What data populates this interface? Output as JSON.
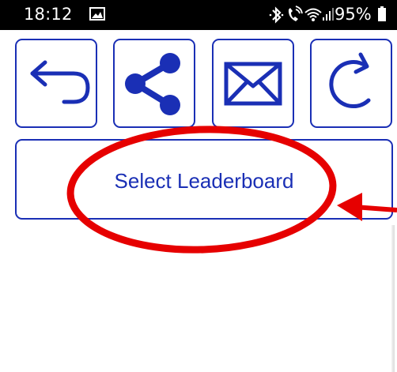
{
  "status_bar": {
    "time": "18:12",
    "battery": "95%",
    "icons": [
      "image-icon",
      "bluetooth-icon",
      "wifi-calling-icon",
      "wifi-icon",
      "signal-icon",
      "battery-icon"
    ]
  },
  "toolbar": {
    "buttons": [
      {
        "name": "back",
        "icon": "back-arrow-icon"
      },
      {
        "name": "share",
        "icon": "share-icon"
      },
      {
        "name": "email",
        "icon": "mail-icon"
      },
      {
        "name": "refresh",
        "icon": "refresh-icon"
      }
    ]
  },
  "main": {
    "select_leaderboard_label": "Select Leaderboard"
  },
  "colors": {
    "accent": "#1a2fb5",
    "annotation": "#e60000",
    "status_bar_bg": "#000000"
  }
}
